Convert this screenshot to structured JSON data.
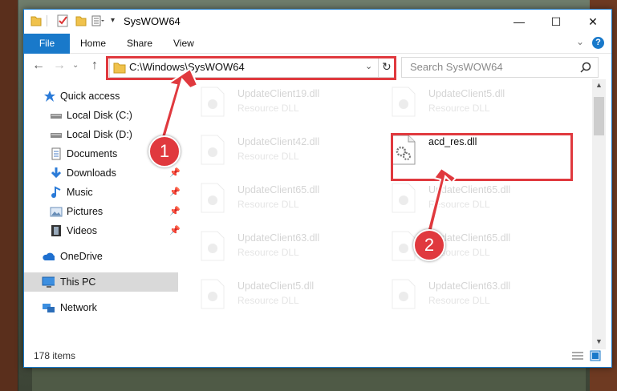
{
  "window": {
    "title": "SysWOW64",
    "controls": {
      "minimize": "—",
      "maximize": "☐",
      "close": "✕"
    }
  },
  "ribbon": {
    "tabs": [
      "File",
      "Home",
      "Share",
      "View"
    ],
    "help": "?",
    "expand": "⌄"
  },
  "nav": {
    "back": "←",
    "forward": "→",
    "recent": "⌄",
    "up": "↑",
    "address": "C:\\Windows\\SysWOW64",
    "refresh": "↻",
    "search_placeholder": "Search SysWOW64"
  },
  "sidebar": {
    "items": [
      {
        "label": "Quick access",
        "icon": "star-icon",
        "pinned": false
      },
      {
        "label": "Local Disk (C:)",
        "icon": "drive-icon",
        "pinned": false
      },
      {
        "label": "Local Disk (D:)",
        "icon": "drive-icon",
        "pinned": false
      },
      {
        "label": "Documents",
        "icon": "documents-icon",
        "pinned": true
      },
      {
        "label": "Downloads",
        "icon": "download-icon",
        "pinned": true
      },
      {
        "label": "Music",
        "icon": "music-icon",
        "pinned": true
      },
      {
        "label": "Pictures",
        "icon": "pictures-icon",
        "pinned": true
      },
      {
        "label": "Videos",
        "icon": "videos-icon",
        "pinned": true
      },
      {
        "label": "OneDrive",
        "icon": "cloud-icon",
        "pinned": false
      },
      {
        "label": "This PC",
        "icon": "pc-icon",
        "pinned": false,
        "selected": true
      },
      {
        "label": "Network",
        "icon": "network-icon",
        "pinned": false
      }
    ]
  },
  "files": [
    {
      "name": "UpdateClient19.dll",
      "type": "Resource DLL",
      "highlight": false
    },
    {
      "name": "UpdateClient5.dll",
      "type": "Resource DLL",
      "highlight": false
    },
    {
      "name": "UpdateClient42.dll",
      "type": "Resource DLL",
      "highlight": false
    },
    {
      "name": "acd_res.dll",
      "type": "",
      "highlight": true
    },
    {
      "name": "UpdateClient65.dll",
      "type": "Resource DLL",
      "highlight": false
    },
    {
      "name": "UpdateClient65.dll",
      "type": "Resource DLL",
      "highlight": false
    },
    {
      "name": "UpdateClient63.dll",
      "type": "Resource DLL",
      "highlight": false
    },
    {
      "name": "UpdateClient65.dll",
      "type": "Resource DLL",
      "highlight": false
    },
    {
      "name": "UpdateClient5.dll",
      "type": "Resource DLL",
      "highlight": false
    },
    {
      "name": "UpdateClient63.dll",
      "type": "Resource DLL",
      "highlight": false
    }
  ],
  "status": {
    "count": "178 items"
  },
  "callouts": [
    "1",
    "2"
  ],
  "colors": {
    "accent": "#1979ca",
    "annotation": "#e0393e"
  }
}
